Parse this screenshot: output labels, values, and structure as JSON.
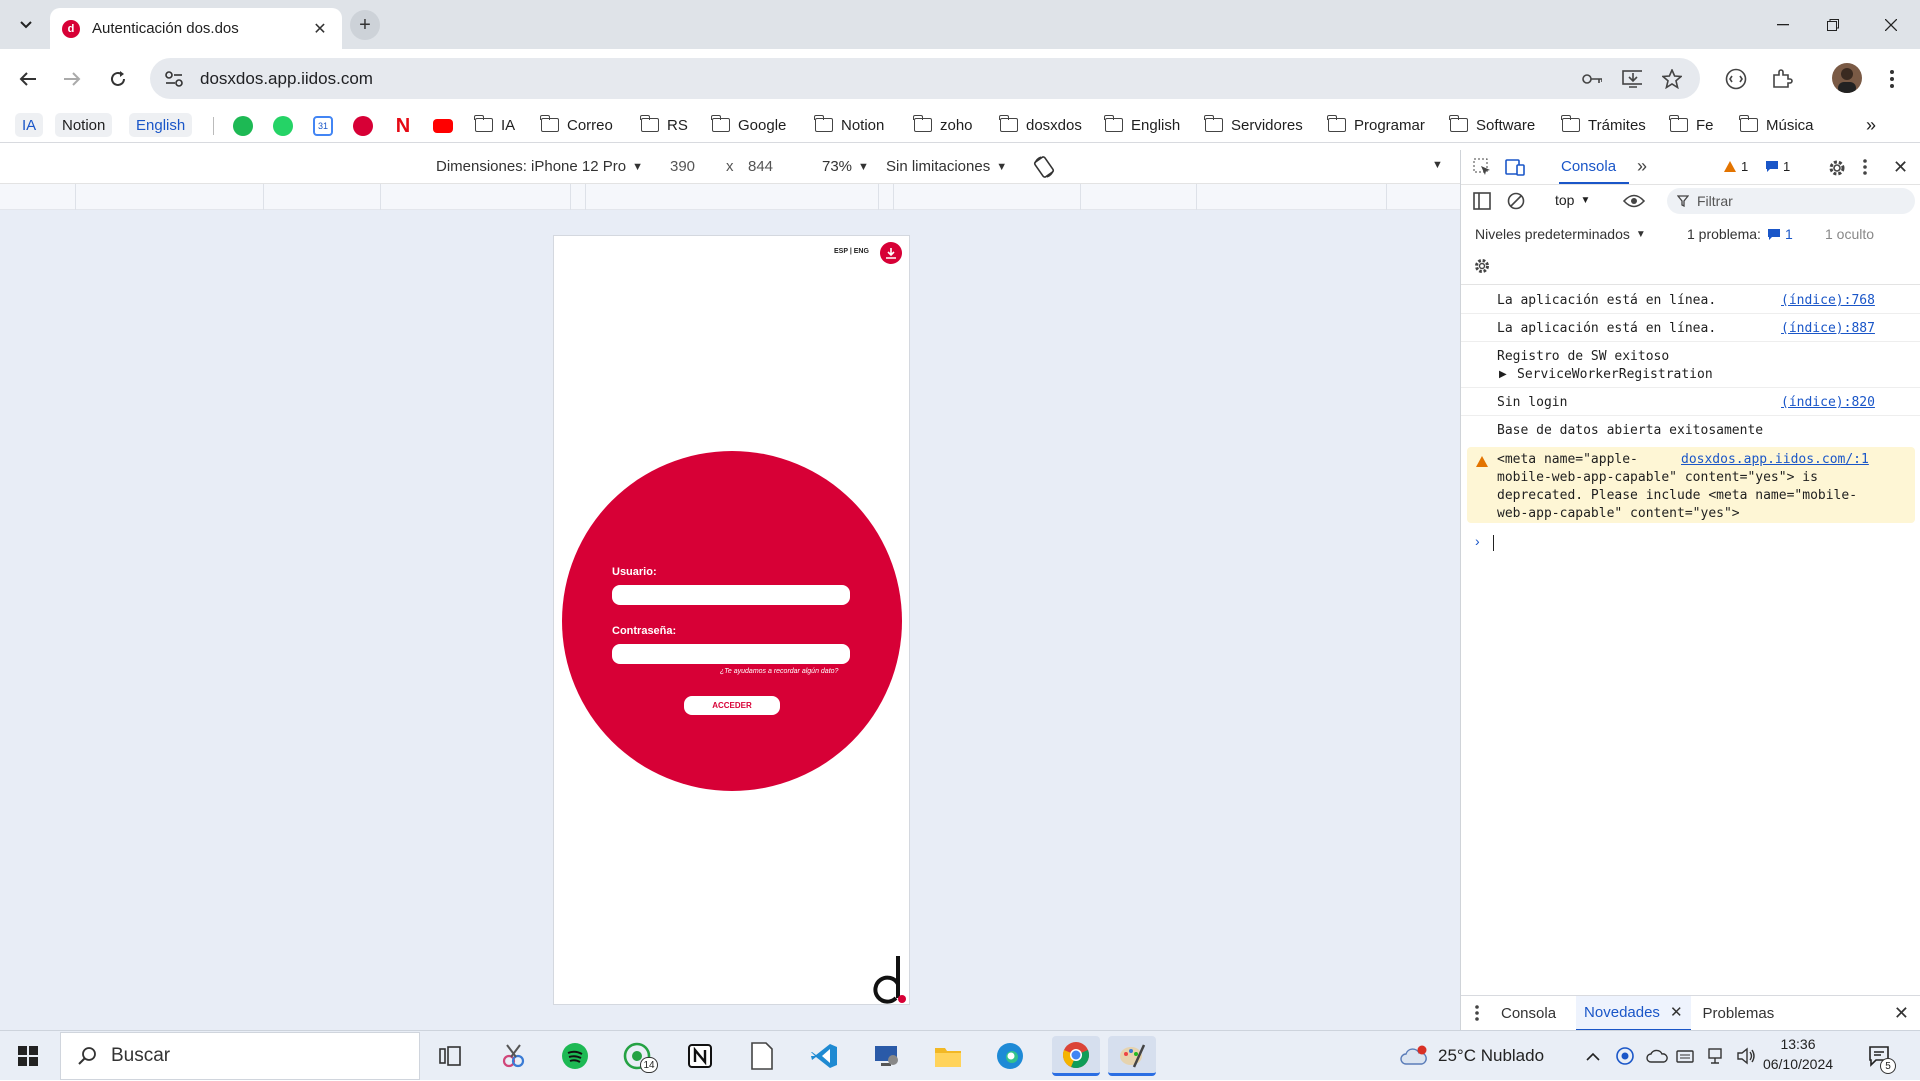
{
  "browser": {
    "tab": {
      "title": "Autenticación dos.dos"
    },
    "url": "dosxdos.app.iidos.com",
    "bookmarks_pills": [
      "IA",
      "Notion",
      "English"
    ],
    "bookmark_folders": [
      "IA",
      "Correo",
      "RS",
      "Google",
      "Notion",
      "zoho",
      "dosxdos",
      "English",
      "Servidores",
      "Programar",
      "Software",
      "Trámites",
      "Fe",
      "Música"
    ],
    "colors": {
      "brand_red": "#d70036",
      "link_blue": "#1a56c8"
    }
  },
  "device_toolbar": {
    "dimensions_label": "Dimensiones: iPhone 12 Pro",
    "width": "390",
    "times": "x",
    "height": "844",
    "zoom": "73%",
    "throttle": "Sin limitaciones"
  },
  "app": {
    "lang_switch": "ESP | ENG",
    "username_label": "Usuario:",
    "password_label": "Contraseña:",
    "forgot_hint": "¿Te ayudamos a recordar algún dato?",
    "submit_label": "ACCEDER"
  },
  "devtools": {
    "tab_console": "Consola",
    "warnings_count": "1",
    "messages_count": "1",
    "context": "top",
    "filter_placeholder": "Filtrar",
    "levels": "Niveles predeterminados",
    "problems": "1 problema:",
    "problems_count": "1",
    "hidden": "1 oculto",
    "logs": [
      {
        "text": "La aplicación está en línea.",
        "source": "(índice):768"
      },
      {
        "text": "La aplicación está en línea.",
        "source": "(índice):887"
      },
      {
        "text": "Registro de SW exitoso",
        "source": ""
      },
      {
        "text": "ServiceWorkerRegistration",
        "source": ""
      },
      {
        "text": "Sin login",
        "source": "(índice):820"
      },
      {
        "text": "Base de datos abierta exitosamente",
        "source": ""
      }
    ],
    "warning": {
      "source": "dosxdos.app.iidos.com/:1",
      "line1": "<meta name=\"apple-",
      "line2": "mobile-web-app-capable\" content=\"yes\"> is",
      "line3": "deprecated. Please include <meta name=\"mobile-",
      "line4": "web-app-capable\" content=\"yes\">"
    },
    "drawer_tabs": [
      "Consola",
      "Novedades",
      "Problemas"
    ]
  },
  "taskbar": {
    "search_placeholder": "Buscar",
    "weather": "25°C  Nublado",
    "time": "13:36",
    "date": "06/10/2024",
    "whatsapp_badge": "14",
    "notif_count": "5"
  }
}
